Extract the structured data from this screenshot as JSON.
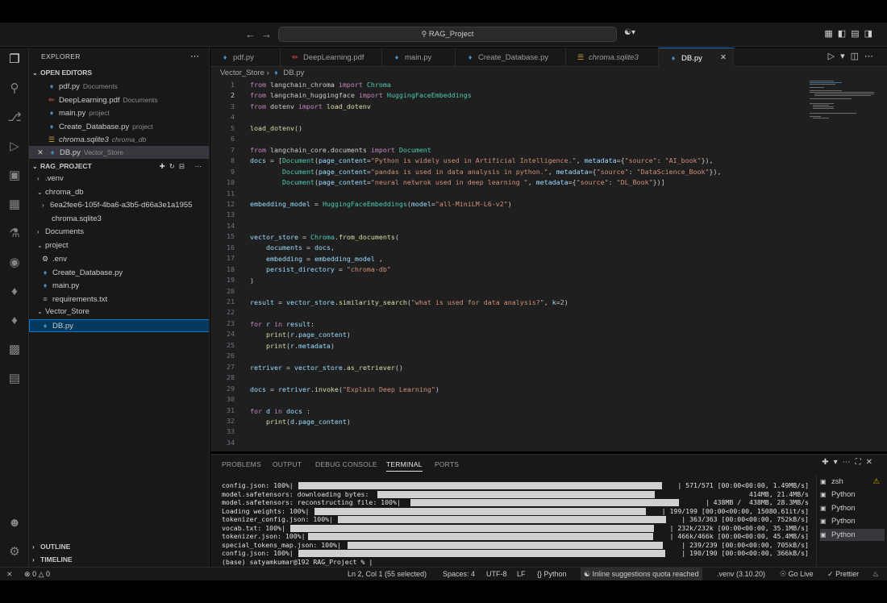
{
  "titlebar": {
    "search_text": "RAG_Project"
  },
  "explorer": {
    "title": "EXPLORER",
    "open_editors_label": "OPEN EDITORS",
    "open_editors": [
      {
        "name": "pdf.py",
        "desc": "Documents",
        "type": "py"
      },
      {
        "name": "DeepLearning.pdf",
        "desc": "Documents",
        "type": "pdf"
      },
      {
        "name": "main.py",
        "desc": "project",
        "type": "py"
      },
      {
        "name": "Create_Database.py",
        "desc": "project",
        "type": "py"
      },
      {
        "name": "chroma.sqlite3",
        "desc": "chroma_db",
        "type": "db"
      },
      {
        "name": "DB.py",
        "desc": "Vector_Store",
        "type": "py"
      }
    ],
    "project_label": "RAG_PROJECT",
    "tree": [
      {
        "name": ".venv"
      },
      {
        "name": "chroma_db"
      },
      {
        "name": "6ea2fee6-105f-4ba6-a3b5-d66a3e1a1955"
      },
      {
        "name": "chroma.sqlite3"
      },
      {
        "name": "Documents"
      },
      {
        "name": "project"
      },
      {
        "name": ".env"
      },
      {
        "name": "Create_Database.py"
      },
      {
        "name": "main.py"
      },
      {
        "name": "requirements.txt"
      },
      {
        "name": "Vector_Store"
      },
      {
        "name": "DB.py"
      }
    ],
    "outline_label": "OUTLINE",
    "timeline_label": "TIMELINE"
  },
  "tabs": [
    {
      "label": "pdf.py"
    },
    {
      "label": "DeepLearning.pdf"
    },
    {
      "label": "main.py"
    },
    {
      "label": "Create_Database.py"
    },
    {
      "label": "chroma.sqlite3"
    },
    {
      "label": "DB.py"
    }
  ],
  "breadcrumb": {
    "folder": "Vector_Store",
    "file": "DB.py"
  },
  "code_line_numbers": [
    "1",
    "2",
    "3",
    "4",
    "5",
    "6",
    "7",
    "8",
    "9",
    "10",
    "11",
    "12",
    "13",
    "14",
    "15",
    "16",
    "17",
    "18",
    "19",
    "20",
    "21",
    "22",
    "23",
    "24",
    "25",
    "26",
    "27",
    "28",
    "29",
    "30",
    "31",
    "32",
    "33",
    "34"
  ],
  "code_tokens": {
    "l1": [
      "from",
      " langchain_chroma ",
      "import",
      " Chroma"
    ],
    "l2": [
      "from",
      " langchain_huggingface ",
      "import",
      " HuggingFaceEmbeddings"
    ],
    "l3": [
      "from",
      " dotenv ",
      "import",
      " load_dotenv"
    ],
    "l5": [
      "load_dotenv",
      "()"
    ],
    "l7": [
      "from",
      " langchain_core.documents ",
      "import",
      " Document"
    ],
    "l8": [
      "docs",
      " = [",
      "Document",
      "(",
      "page_content",
      "=",
      "\"Python is widely used in Artificial Intelligence.\"",
      ", ",
      "metadata",
      "={",
      "\"source\"",
      ": ",
      "\"AI_book\"",
      "}),"
    ],
    "l9": [
      "        ",
      "Document",
      "(",
      "page_content",
      "=",
      "\"pandas is used in data analysis in python.\"",
      ", ",
      "metadata",
      "={",
      "\"source\"",
      ": ",
      "\"DataScience_Book\"",
      "}),"
    ],
    "l10": [
      "        ",
      "Document",
      "(",
      "page_content",
      "=",
      "\"neural netwrok used in deep learning \"",
      ", ",
      "metadata",
      "={",
      "\"source\"",
      ": ",
      "\"DL_Book\"",
      "})]"
    ],
    "l12": [
      "embedding_model",
      " = ",
      "HuggingFaceEmbeddings",
      "(",
      "model",
      "=",
      "\"all-MiniLM-L6-v2\"",
      ")"
    ],
    "l15": [
      "vector_store",
      " = ",
      "Chroma",
      ".",
      "from_documents",
      "("
    ],
    "l16": [
      "    ",
      "documents",
      " = ",
      "docs",
      ","
    ],
    "l17": [
      "    ",
      "embedding",
      " = ",
      "embedding_model",
      " ,"
    ],
    "l18": [
      "    ",
      "persist_directory",
      " = ",
      "\"chroma-db\""
    ],
    "l19": [
      ")"
    ],
    "l21": [
      "result",
      " = ",
      "vector_store",
      ".",
      "similarity_search",
      "(",
      "\"what is used for data analysis?\"",
      ", ",
      "k",
      "=",
      "2",
      ")"
    ],
    "l23": [
      "for",
      " ",
      "r",
      " ",
      "in",
      " ",
      "result",
      ":"
    ],
    "l24": [
      "    ",
      "print",
      "(",
      "r",
      ".",
      "page_content",
      ")"
    ],
    "l25": [
      "    ",
      "print",
      "(",
      "r",
      ".",
      "metadata",
      ")"
    ],
    "l27": [
      "retriver",
      " = ",
      "vector_store",
      ".",
      "as_retriever",
      "()"
    ],
    "l29": [
      "docs",
      " = ",
      "retriver",
      ".",
      "invoke",
      "(",
      "\"Explain Deep Learning\"",
      ")"
    ],
    "l31": [
      "for",
      " ",
      "d",
      " ",
      "in",
      " ",
      "docs",
      " :"
    ],
    "l32": [
      "    ",
      "print",
      "(",
      "d",
      ".",
      "page_content",
      ")"
    ]
  },
  "panel": {
    "tabs": [
      {
        "label": "PROBLEMS"
      },
      {
        "label": "OUTPUT"
      },
      {
        "label": "DEBUG CONSOLE"
      },
      {
        "label": "TERMINAL"
      },
      {
        "label": "PORTS"
      }
    ],
    "terminal_lines": [
      {
        "label": "config.json: 100%|",
        "right": "| 571/571 [00:00<00:00, 1.49MB/s]",
        "progress": 1.0
      },
      {
        "label": "model.safetensors: downloading bytes:",
        "right": "  414MB, 21.4MB/s",
        "progress": 0.82
      },
      {
        "label": "model.safetensors: reconstructing file: 100%|",
        "right": "| 438MB /  438MB, 28.3MB/s",
        "progress": 1.0
      },
      {
        "label": "Loading weights: 100%|",
        "right": "| 199/199 [00:00<00:00, 15080.61it/s]",
        "progress": 1.0
      },
      {
        "label": "tokenizer_config.json: 100%|",
        "right": "| 363/363 [00:00<00:00, 752kB/s]",
        "progress": 1.0
      },
      {
        "label": "vocab.txt: 100%|",
        "right": "| 232k/232k [00:00<00:00, 35.1MB/s]",
        "progress": 1.0
      },
      {
        "label": "tokenizer.json: 100%|",
        "right": "| 466k/466k [00:00<00:00, 45.4MB/s]",
        "progress": 1.0
      },
      {
        "label": "special_tokens_map.json: 100%|",
        "right": "| 239/239 [00:00<00:00, 705kB/s]",
        "progress": 1.0
      },
      {
        "label": "config.json: 100%|",
        "right": "| 190/190 [00:00<00:00, 366kB/s]",
        "progress": 1.0
      },
      {
        "label": "(base) satyamkumar@192 RAG_Project % |",
        "right": "",
        "progress": 0
      }
    ],
    "terminal_list": [
      {
        "label": "zsh"
      },
      {
        "label": "Python"
      },
      {
        "label": "Python"
      },
      {
        "label": "Python"
      },
      {
        "label": "Python"
      }
    ]
  },
  "statusbar": {
    "errors": "0",
    "warnings": "0",
    "position": "Ln 2, Col 1 (55 selected)",
    "spaces": "Spaces: 4",
    "encoding": "UTF-8",
    "eol": "LF",
    "language": "Python",
    "suggestions": "Inline suggestions quota reached",
    "venv": ".venv (3.10.20)",
    "golive": "Go Live",
    "prettier": "Prettier"
  }
}
